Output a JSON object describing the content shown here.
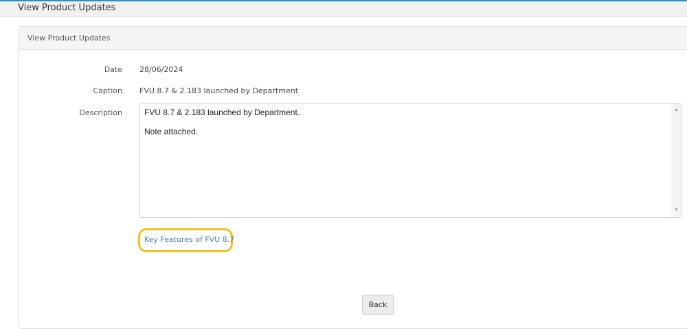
{
  "header": {
    "title": "View Product Updates"
  },
  "panel": {
    "title": "View Product Updates",
    "fields": {
      "date_label": "Date",
      "date_value": "28/06/2024",
      "caption_label": "Caption",
      "caption_value": "FVU 8.7 & 2.183 launched by Department",
      "description_label": "Description",
      "description_value": "FVU 8.7 & 2.183 launched by Department.\n\nNote attached."
    },
    "link": "Key Features of FVU 8.7",
    "back_label": "Back"
  },
  "colors": {
    "accent": "#2a8fc4",
    "highlight": "#f2c21b",
    "link": "#4a7fae"
  }
}
